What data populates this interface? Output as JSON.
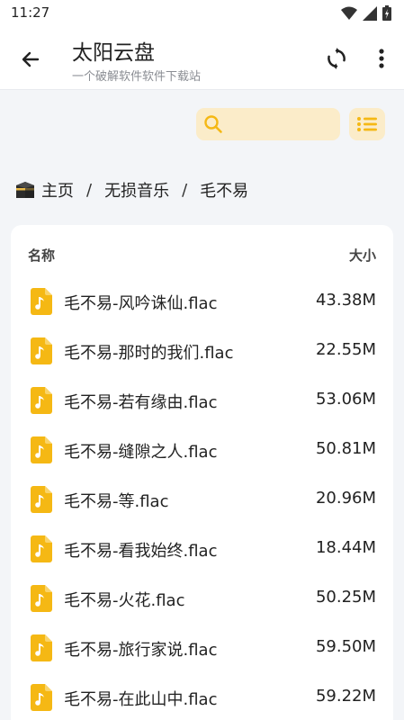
{
  "status": {
    "time": "11:27"
  },
  "appbar": {
    "title": "太阳云盘",
    "subtitle": "一个破解软件软件下载站"
  },
  "search": {
    "placeholder": "",
    "value": ""
  },
  "breadcrumb": {
    "items": [
      "主页",
      "无损音乐",
      "毛不易"
    ],
    "separator": "/"
  },
  "table": {
    "col_name": "名称",
    "col_size": "大小",
    "rows": [
      {
        "name": "毛不易-风吟诛仙.flac",
        "size": "43.38M"
      },
      {
        "name": "毛不易-那时的我们.flac",
        "size": "22.55M"
      },
      {
        "name": "毛不易-若有缘由.flac",
        "size": "53.06M"
      },
      {
        "name": "毛不易-缝隙之人.flac",
        "size": "50.81M"
      },
      {
        "name": "毛不易-等.flac",
        "size": "20.96M"
      },
      {
        "name": "毛不易-看我始终.flac",
        "size": "18.44M"
      },
      {
        "name": "毛不易-火花.flac",
        "size": "50.25M"
      },
      {
        "name": "毛不易-旅行家说.flac",
        "size": "59.50M"
      },
      {
        "name": "毛不易-在此山中.flac",
        "size": "59.22M"
      }
    ]
  },
  "colors": {
    "accent": "#f5b814",
    "accent_light": "#fbecc9",
    "background": "#f3f5f8"
  },
  "icons": {
    "back": "arrow-left-icon",
    "refresh": "refresh-icon",
    "more": "more-vert-icon",
    "search": "search-icon",
    "list": "list-view-icon",
    "home": "kaaba-icon",
    "file": "music-file-icon"
  }
}
